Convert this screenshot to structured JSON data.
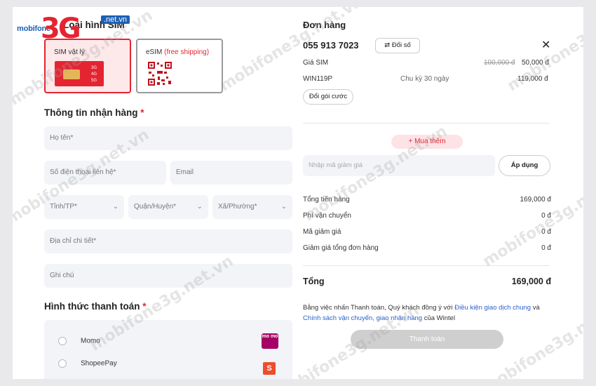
{
  "logo": {
    "brand": "mobifone",
    "big": "3G",
    "net": ".net.vn"
  },
  "left": {
    "sim_type_title": "Loại hình SIM",
    "sim_physical_label": "SIM vật lý",
    "esim_label": "eSIM",
    "esim_free": "(free shipping)",
    "sim_gen": [
      "3G",
      "4G",
      "5G"
    ],
    "receiver_title": "Thông tin nhận hàng",
    "required_mark": "*",
    "fields": {
      "name": "Họ tên*",
      "phone": "Số điện thoại liên hệ*",
      "email": "Email",
      "province": "Tỉnh/TP*",
      "district": "Quận/Huyện*",
      "ward": "Xã/Phường*",
      "address": "Địa chỉ chi tiết*",
      "note": "Ghi chú"
    },
    "payment_title": "Hình thức thanh toán",
    "payment_methods": [
      "Momo",
      "ShopeePay"
    ],
    "momo_logo": "mo mo",
    "shopee_logo": "S"
  },
  "right": {
    "order_title": "Đơn hàng",
    "phone_number": "055 913 7023",
    "change_number": "Đổi số",
    "sim_price_label": "Giá SIM",
    "sim_old_price": "100,000 đ",
    "sim_price": "50,000 đ",
    "plan_code": "WIN119P",
    "plan_cycle": "Chu kỳ 30 ngày",
    "plan_price": "119,000 đ",
    "change_plan": "Đổi gói cước",
    "buy_more": "+ Mua thêm",
    "coupon_placeholder": "Nhập mã giảm giá",
    "apply": "Áp dụng",
    "summary": [
      {
        "label": "Tổng tiền hàng",
        "value": "169,000 đ"
      },
      {
        "label": "Phí vận chuyển",
        "value": "0 đ"
      },
      {
        "label": "Mã giảm giá",
        "value": "0 đ"
      },
      {
        "label": "Giảm giá tổng đơn hàng",
        "value": "0 đ"
      }
    ],
    "total_label": "Tổng",
    "total_value": "169,000 đ",
    "terms_prefix": "Bằng việc nhấn Thanh toán, Quý khách đồng ý với",
    "terms_link1": "Điều kiện giao dịch chung",
    "terms_and": "và",
    "terms_link2": "Chính sách vận chuyển, giao nhận hàng",
    "terms_suffix": "của Wintel",
    "pay_button": "Thanh toán"
  },
  "watermark": "mobifone3g.net.vn",
  "colors": {
    "accent": "#e52431",
    "link": "#2a62c9",
    "pay_button_disabled": "#cfcfcf"
  }
}
